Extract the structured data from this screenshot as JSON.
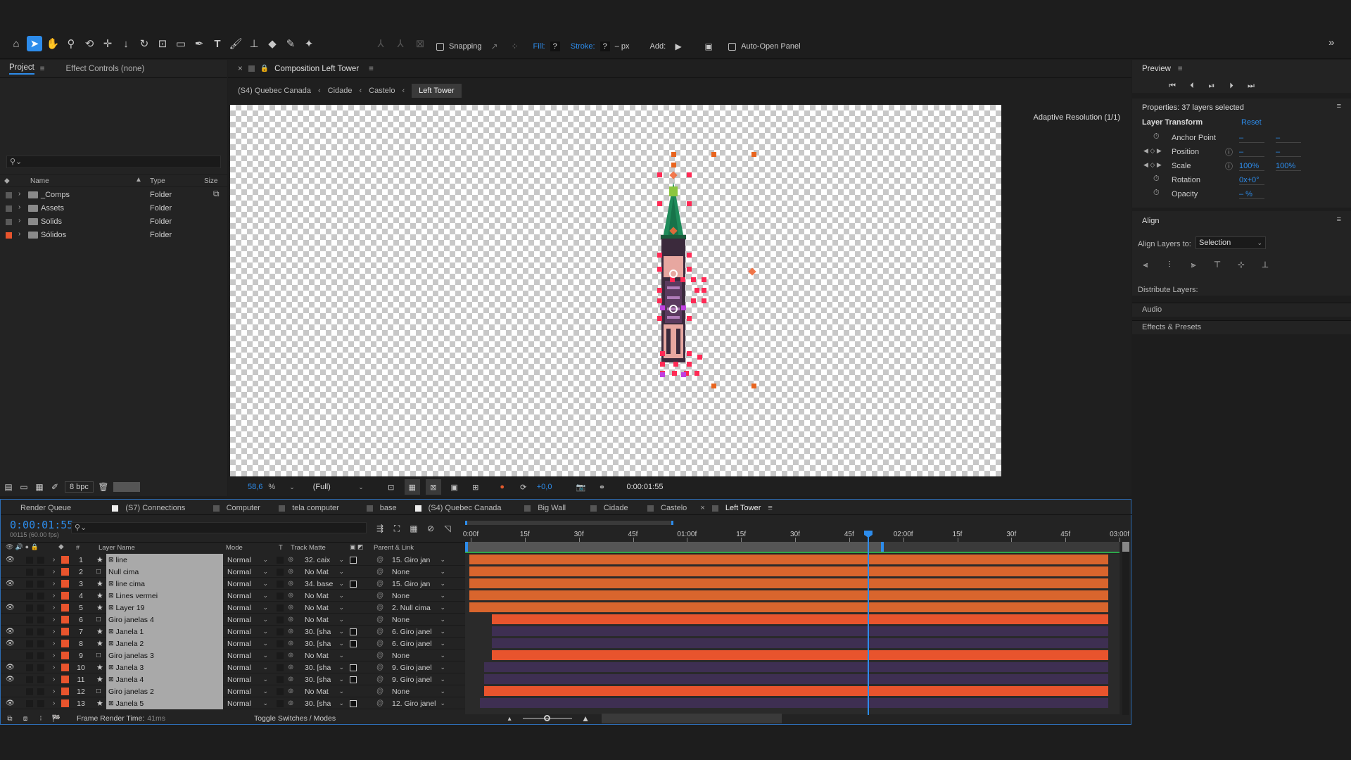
{
  "toolbar": {
    "snapping_label": "Snapping",
    "fill_label": "Fill:",
    "fill_value": "?",
    "stroke_label": "Stroke:",
    "stroke_value": "?",
    "stroke_unit": "– px",
    "add_label": "Add:",
    "auto_open_label": "Auto-Open Panel",
    "expand_glyph": "»"
  },
  "project_panel": {
    "tab_project": "Project",
    "tab_effect_controls": "Effect Controls (none)",
    "search_placeholder": "",
    "columns": {
      "name": "Name",
      "type": "Type",
      "size": "Size"
    },
    "items": [
      {
        "name": "_Comps",
        "type": "Folder",
        "color": "#5a5a5a"
      },
      {
        "name": "Assets",
        "type": "Folder",
        "color": "#5a5a5a"
      },
      {
        "name": "Solids",
        "type": "Folder",
        "color": "#5a5a5a"
      },
      {
        "name": "Sólidos",
        "type": "Folder",
        "color": "#e8542d"
      }
    ],
    "bpc": "8 bpc"
  },
  "composition": {
    "tab_title": "Composition Left Tower",
    "breadcrumbs": [
      "(S4) Quebec Canada",
      "Cidade",
      "Castelo",
      "Left Tower"
    ],
    "adaptive_resolution": "Adaptive Resolution (1/1)",
    "zoom": "58,6",
    "zoom_unit": "%",
    "resolution": "(Full)",
    "exposure": "+0,0",
    "timecode": "0:00:01:55"
  },
  "preview_panel": {
    "title": "Preview"
  },
  "properties_panel": {
    "title": "Properties: 37 layers selected",
    "section": "Layer Transform",
    "reset_label": "Reset",
    "props": [
      {
        "name": "Anchor Point",
        "v1": "–",
        "v2": "–"
      },
      {
        "name": "Position",
        "v1": "–",
        "v2": "–"
      },
      {
        "name": "Scale",
        "v1": "100%",
        "v2": "100%"
      },
      {
        "name": "Rotation",
        "v1": "0x+0°",
        "v2": ""
      },
      {
        "name": "Opacity",
        "v1": "– %",
        "v2": ""
      }
    ]
  },
  "align_panel": {
    "title": "Align",
    "align_to_label": "Align Layers to:",
    "align_to_value": "Selection",
    "distribute_label": "Distribute Layers:",
    "audio_label": "Audio",
    "effects_label": "Effects & Presets"
  },
  "timeline": {
    "tabs": [
      {
        "label": "Render Queue",
        "swatch": ""
      },
      {
        "label": "(S7) Connections",
        "swatch": "#eeeeee"
      },
      {
        "label": "Computer",
        "swatch": "#555555"
      },
      {
        "label": "tela computer",
        "swatch": "#555555"
      },
      {
        "label": "base",
        "swatch": "#555555"
      },
      {
        "label": "(S4) Quebec Canada",
        "swatch": "#eeeeee"
      },
      {
        "label": "Big Wall",
        "swatch": "#555555"
      },
      {
        "label": "Cidade",
        "swatch": "#555555"
      },
      {
        "label": "Castelo",
        "swatch": "#555555"
      },
      {
        "label": "Left Tower",
        "swatch": "#555555"
      }
    ],
    "current_time": "0:00:01:55",
    "frame_info": "00115 (60.00 fps)",
    "columns": {
      "layer_name": "Layer Name",
      "mode": "Mode",
      "t": "T",
      "track_matte": "Track Matte",
      "parent": "Parent & Link"
    },
    "ruler": [
      "0:00f",
      "15f",
      "30f",
      "45f",
      "01:00f",
      "15f",
      "30f",
      "45f",
      "02:00f",
      "15f",
      "30f",
      "45f",
      "03:00f"
    ],
    "layers": [
      {
        "num": "1",
        "name": "line",
        "star": true,
        "color": "#e8542d",
        "eye": true,
        "mode": "Normal",
        "matte": "32. caix",
        "matte_icon": true,
        "parent": "15. Giro jan",
        "bar": "#d9652d",
        "start": 0.0
      },
      {
        "num": "2",
        "name": "Null cima",
        "star": false,
        "color": "#e8542d",
        "eye": false,
        "mode": "Normal",
        "matte": "No Mat",
        "matte_icon": false,
        "parent": "None",
        "bar": "#d9652d",
        "start": 0.0
      },
      {
        "num": "3",
        "name": "line cima",
        "star": true,
        "color": "#e8542d",
        "eye": true,
        "mode": "Normal",
        "matte": "34. base",
        "matte_icon": true,
        "parent": "15. Giro jan",
        "bar": "#d9652d",
        "start": 0.0
      },
      {
        "num": "4",
        "name": "Lines vermei",
        "star": true,
        "color": "#e8542d",
        "eye": false,
        "mode": "Normal",
        "matte": "No Mat",
        "matte_icon": false,
        "parent": "None",
        "bar": "#d9652d",
        "start": 0.0
      },
      {
        "num": "5",
        "name": "Layer 19",
        "star": true,
        "color": "#e8542d",
        "eye": true,
        "mode": "Normal",
        "matte": "No Mat",
        "matte_icon": false,
        "parent": "2. Null cima",
        "bar": "#d9652d",
        "start": 0.0
      },
      {
        "num": "6",
        "name": "Giro janelas 4",
        "star": false,
        "color": "#e8542d",
        "eye": false,
        "mode": "Normal",
        "matte": "No Mat",
        "matte_icon": false,
        "parent": "None",
        "bar": "#e8542d",
        "start": 0.034
      },
      {
        "num": "7",
        "name": "Janela 1",
        "star": true,
        "color": "#e8542d",
        "eye": true,
        "mode": "Normal",
        "matte": "30. [sha",
        "matte_icon": true,
        "parent": "6. Giro janel",
        "bar": "#3e2f52",
        "start": 0.034
      },
      {
        "num": "8",
        "name": "Janela 2",
        "star": true,
        "color": "#e8542d",
        "eye": true,
        "mode": "Normal",
        "matte": "30. [sha",
        "matte_icon": true,
        "parent": "6. Giro janel",
        "bar": "#3e2f52",
        "start": 0.034
      },
      {
        "num": "9",
        "name": "Giro janelas 3",
        "star": false,
        "color": "#e8542d",
        "eye": false,
        "mode": "Normal",
        "matte": "No Mat",
        "matte_icon": false,
        "parent": "None",
        "bar": "#e8542d",
        "start": 0.034
      },
      {
        "num": "10",
        "name": "Janela 3",
        "star": true,
        "color": "#e8542d",
        "eye": true,
        "mode": "Normal",
        "matte": "30. [sha",
        "matte_icon": true,
        "parent": "9. Giro janel",
        "bar": "#3e2f52",
        "start": 0.023
      },
      {
        "num": "11",
        "name": "Janela 4",
        "star": true,
        "color": "#e8542d",
        "eye": true,
        "mode": "Normal",
        "matte": "30. [sha",
        "matte_icon": true,
        "parent": "9. Giro janel",
        "bar": "#3e2f52",
        "start": 0.023
      },
      {
        "num": "12",
        "name": "Giro janelas 2",
        "star": false,
        "color": "#e8542d",
        "eye": false,
        "mode": "Normal",
        "matte": "No Mat",
        "matte_icon": false,
        "parent": "None",
        "bar": "#e8542d",
        "start": 0.023
      },
      {
        "num": "13",
        "name": "Janela 5",
        "star": true,
        "color": "#e8542d",
        "eye": true,
        "mode": "Normal",
        "matte": "30. [sha",
        "matte_icon": true,
        "parent": "12. Giro janel",
        "bar": "#3e2f52",
        "start": 0.016
      }
    ],
    "playhead_fraction": 0.615,
    "frame_render_time_label": "Frame Render Time:",
    "frame_render_time": "41ms",
    "toggle_label": "Toggle Switches / Modes"
  }
}
